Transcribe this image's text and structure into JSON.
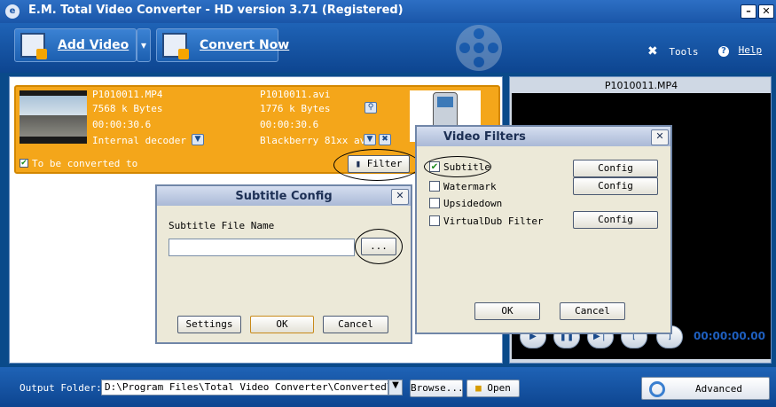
{
  "window": {
    "title": "E.M. Total Video Converter -  HD version 3.71 (Registered)",
    "minimize_label": "–",
    "close_label": "✕"
  },
  "toolbar": {
    "add_video": "Add Video",
    "add_video_dropdown": "▾",
    "convert_now": "Convert Now",
    "tools": "Tools",
    "help": "Help"
  },
  "file": {
    "source_name": "P1010011.MP4",
    "source_size": "7568 k Bytes",
    "source_duration": "00:00:30.6",
    "decoder": "Internal decoder",
    "target_name": "P1010011.avi",
    "target_size": "1776 k Bytes",
    "target_duration": "00:00:30.6",
    "target_profile": "Blackberry 81xx avi",
    "to_be_converted": "To be converted to",
    "filter_button": "Filter"
  },
  "preview": {
    "title": "P1010011.MP4",
    "timecode": "00:00:00.00"
  },
  "bottom": {
    "output_label": "Output Folder:",
    "output_path": "D:\\Program Files\\Total Video Converter\\Converted\\",
    "browse": "Browse...",
    "open": "Open",
    "advanced": "Advanced"
  },
  "subtitle_dialog": {
    "title": "Subtitle Config",
    "file_label": "Subtitle File Name",
    "file_value": "",
    "browse_button": "...",
    "settings": "Settings",
    "ok": "OK",
    "cancel": "Cancel"
  },
  "filters_dialog": {
    "title": "Video Filters",
    "filters": [
      {
        "label": "Subtitle",
        "checked": true,
        "config": "Config"
      },
      {
        "label": "Watermark",
        "checked": false,
        "config": "Config"
      },
      {
        "label": "Upsidedown",
        "checked": false
      },
      {
        "label": "VirtualDub Filter",
        "checked": false,
        "config": "Config"
      }
    ],
    "ok": "OK",
    "cancel": "Cancel"
  }
}
